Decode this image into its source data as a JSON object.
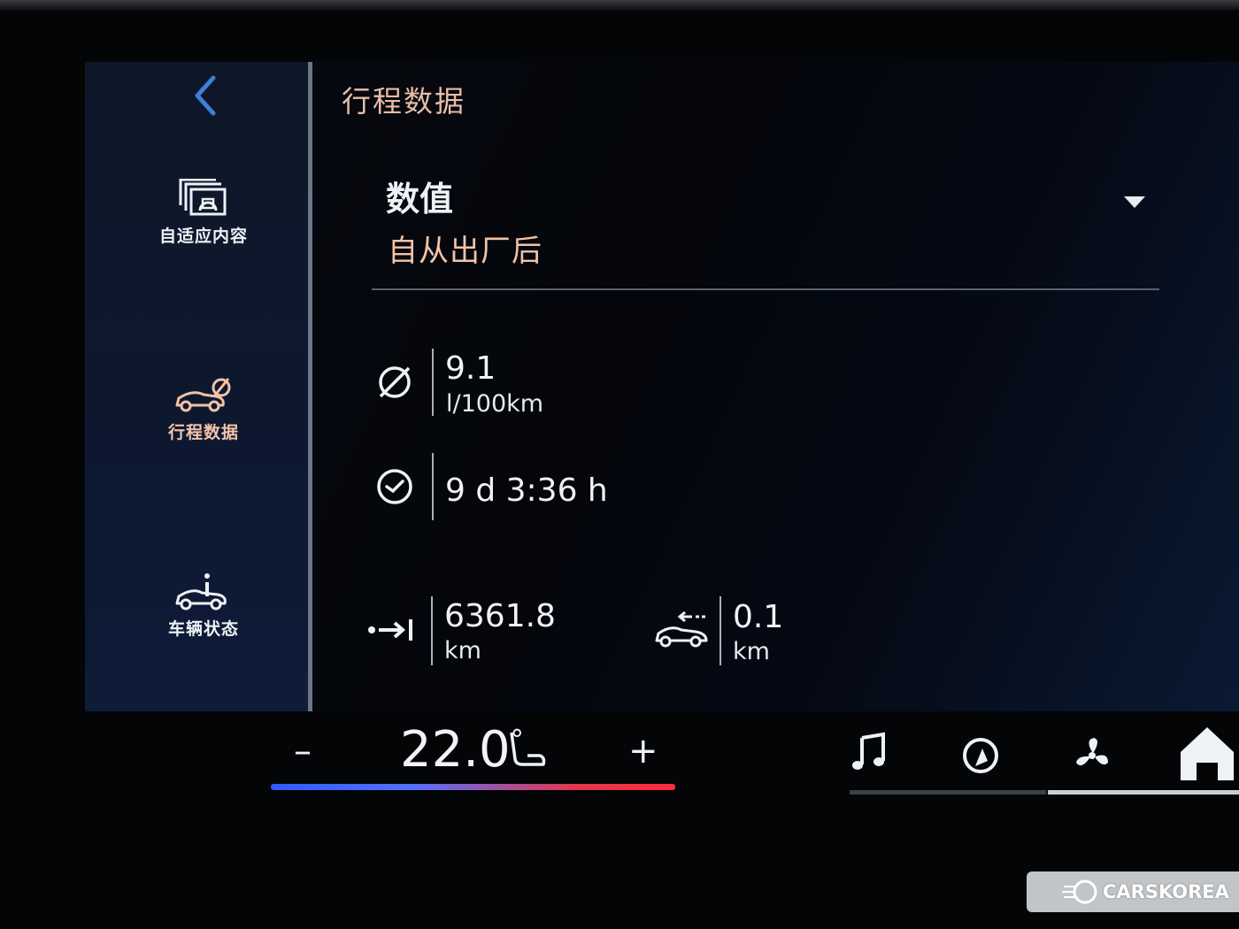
{
  "header": {
    "title": "行程数据",
    "back_icon": "chevron-left-icon"
  },
  "sidebar": {
    "items": [
      {
        "label": "自适应内容",
        "icon": "adaptive-content-icon",
        "active": false
      },
      {
        "label": "行程数据",
        "icon": "trip-data-car-icon",
        "active": true
      },
      {
        "label": "车辆状态",
        "icon": "vehicle-status-icon",
        "active": false
      }
    ]
  },
  "dropdown": {
    "value": "数值",
    "subtitle": "自从出厂后",
    "icon": "caret-down-icon"
  },
  "metrics": {
    "consumption": {
      "icon": "average-symbol-icon",
      "value": "9.1",
      "unit": "l/100km"
    },
    "duration": {
      "icon": "clock-icon",
      "value": "9 d 3:36 h"
    },
    "distance": {
      "icon": "distance-arrow-icon",
      "value": "6361.8",
      "unit": "km"
    },
    "coasting": {
      "icon": "car-coasting-icon",
      "value": "0.1",
      "unit": "km"
    }
  },
  "climate": {
    "minus": "–",
    "plus": "+",
    "temperature": "22.0",
    "degree": "°",
    "seat_icon": "seat-icon"
  },
  "dock": {
    "items": [
      {
        "icon": "music-note-icon"
      },
      {
        "icon": "navigation-icon"
      },
      {
        "icon": "fan-icon",
        "active": true
      },
      {
        "icon": "home-icon"
      }
    ]
  },
  "watermark": {
    "text": "CARSKOREA"
  },
  "colors": {
    "accent": "#f2c3a6",
    "blue": "#3f7fd9",
    "temp_cold": "#2f5bff",
    "temp_hot": "#ff2a3a"
  }
}
